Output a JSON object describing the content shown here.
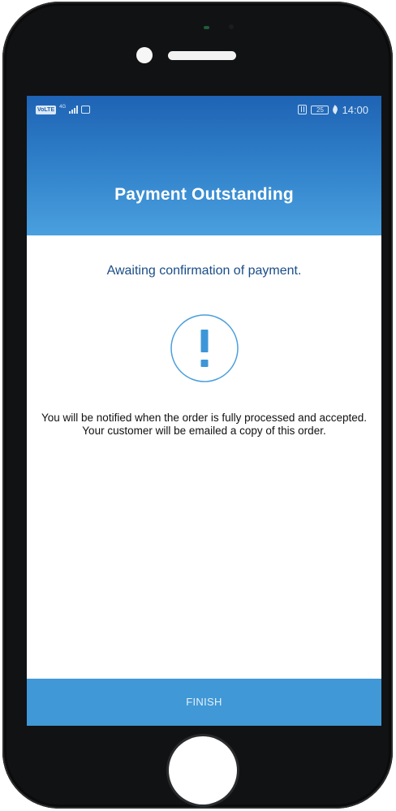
{
  "status_bar": {
    "volte": "VoLTE",
    "network": "4G",
    "battery": "25",
    "time": "14:00",
    "icons": [
      "volte-icon",
      "signal-icon",
      "message-icon",
      "nfc-icon",
      "battery-icon",
      "eco-leaf-icon"
    ]
  },
  "header": {
    "title": "Payment Outstanding"
  },
  "body": {
    "subtitle": "Awaiting confirmation of payment.",
    "alert_icon": "exclamation-circle-icon",
    "message": "You will be notified when the order is fully processed and accepted. Your customer will be emailed a copy of this order."
  },
  "footer": {
    "finish_label": "FINISH"
  },
  "colors": {
    "header_top": "#1f63b4",
    "header_bottom": "#4aa0de",
    "accent": "#4098d6",
    "subtitle_text": "#1a4d87",
    "phone_body": "#111213"
  }
}
